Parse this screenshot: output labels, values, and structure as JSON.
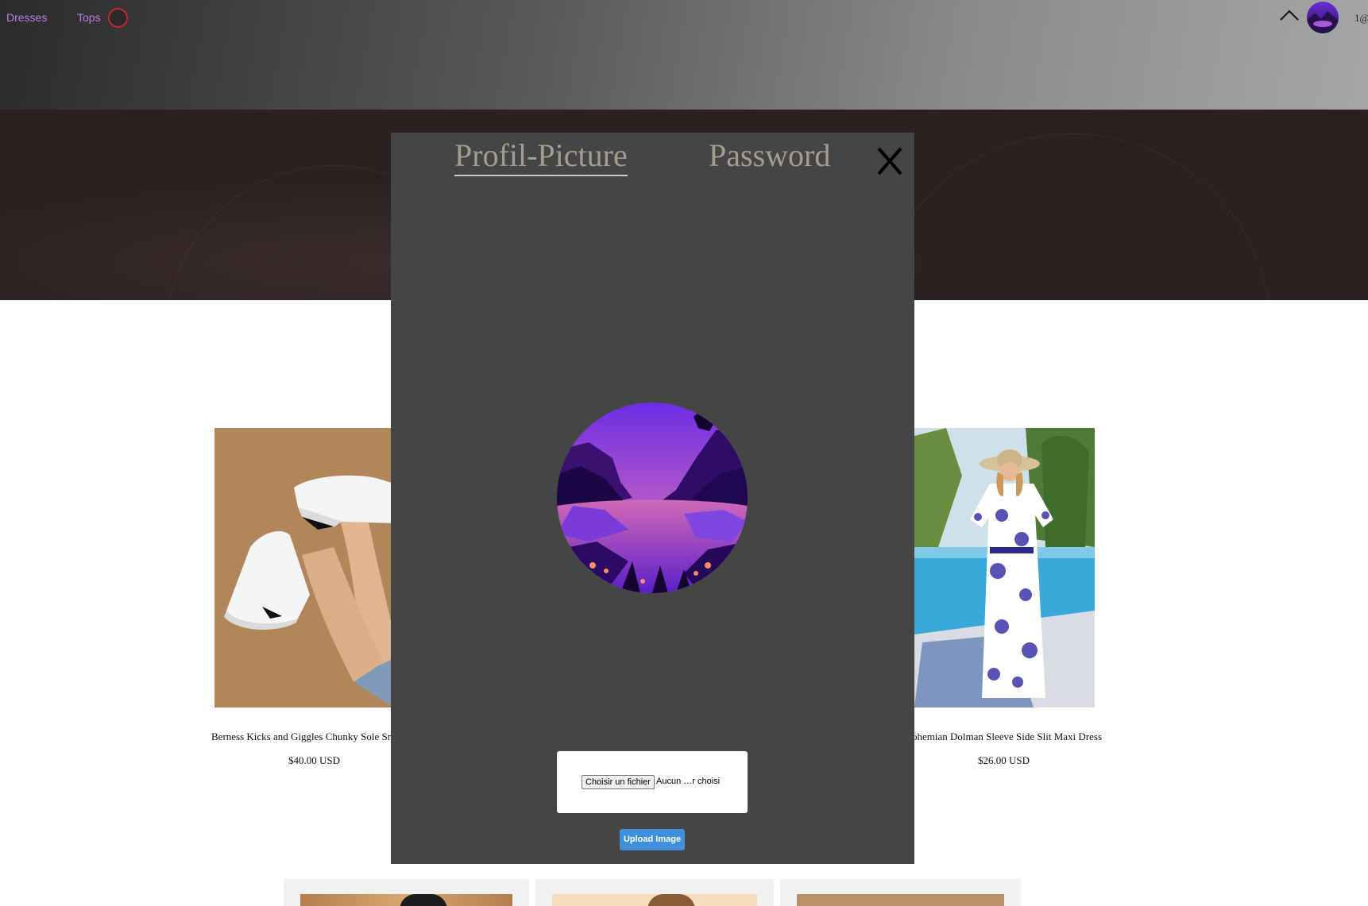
{
  "nav": {
    "links": [
      "Dresses",
      "Tops"
    ],
    "link_color": "#b77ee6"
  },
  "user": {
    "label": "1@"
  },
  "products": [
    {
      "title": "Berness Kicks and Giggles Chunky Sole Sn",
      "price": "$40.00 USD"
    },
    {
      "title": "ohemian Dolman Sleeve Side Slit Maxi Dress",
      "price": "$26.00 USD"
    }
  ],
  "modal": {
    "tabs": [
      {
        "label": "Profil-Picture",
        "active": true
      },
      {
        "label": "Password",
        "active": false
      }
    ],
    "file_button_label": "Choisir un fichier",
    "file_status": "Aucun …r choisi",
    "upload_label": "Upload Image",
    "upload_color": "#3f90d8",
    "background": "#454545"
  },
  "icons": {
    "close": "close-icon",
    "chevron": "chevron-up-icon"
  }
}
